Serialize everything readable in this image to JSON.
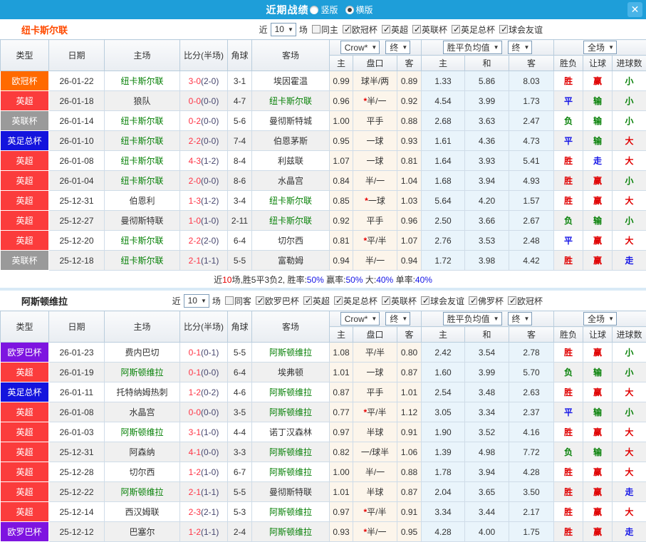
{
  "titlebar": {
    "title": "近期战绩",
    "radios": [
      {
        "label": "竖版",
        "selected": false
      },
      {
        "label": "横版",
        "selected": true
      }
    ]
  },
  "icons": {
    "close": "✕",
    "dropdown_arrow": "▼",
    "checkmark": "✓"
  },
  "colors": {
    "titlebar_bg": "#1e9ed9",
    "tracked_team_green": "#068006",
    "score_ft_red": "#ff3344",
    "win_red": "#e00000",
    "draw_blue": "#1414e6",
    "lose_green": "#068006",
    "leagues": {
      "欧冠杯": "#ff6a00",
      "英超": "#fb3c3c",
      "英联杯": "#9a9a9a",
      "英足总杯": "#1414dd",
      "欧罗巴杯": "#7e14e0"
    }
  },
  "sections": [
    {
      "team": "纽卡斯尔联",
      "team_color": "#ff4a00",
      "filters": {
        "near": "近",
        "count": "10",
        "games": "场",
        "same": "同主",
        "same_checked": false,
        "leagues": [
          "欧冠杯",
          "英超",
          "英联杯",
          "英足总杯",
          "球会友谊"
        ]
      },
      "selects": {
        "source": "Crow*",
        "final_a": "终",
        "mean": "胜平负均值",
        "final_b": "终",
        "scope": "全场"
      },
      "headers": {
        "type": "类型",
        "date": "日期",
        "home": "主场",
        "score": "比分(半场)",
        "corner": "角球",
        "away": "客场",
        "h": "主",
        "handicap": "盘口",
        "a": "客",
        "mh": "主",
        "md": "和",
        "ma": "客",
        "result": "胜负",
        "let": "让球",
        "goals": "进球数"
      },
      "rows": [
        {
          "league": "欧冠杯",
          "date": "26-01-22",
          "home": "纽卡斯尔联",
          "home_team": true,
          "ft": "3-0",
          "ht": "(2-0)",
          "corner": "3-1",
          "away": "埃因霍温",
          "away_team": false,
          "oh": "0.99",
          "hc": "球半/两",
          "star": false,
          "oa": "0.89",
          "mh": "1.33",
          "md": "5.86",
          "ma": "8.03",
          "res": "胜",
          "let": "赢",
          "goal": "小"
        },
        {
          "league": "英超",
          "date": "26-01-18",
          "home": "狼队",
          "home_team": false,
          "ft": "0-0",
          "ht": "(0-0)",
          "corner": "4-7",
          "away": "纽卡斯尔联",
          "away_team": true,
          "oh": "0.96",
          "hc": "半/一",
          "star": true,
          "oa": "0.92",
          "mh": "4.54",
          "md": "3.99",
          "ma": "1.73",
          "res": "平",
          "let": "输",
          "goal": "小"
        },
        {
          "league": "英联杯",
          "date": "26-01-14",
          "home": "纽卡斯尔联",
          "home_team": true,
          "ft": "0-2",
          "ht": "(0-0)",
          "corner": "5-6",
          "away": "曼彻斯特城",
          "away_team": false,
          "oh": "1.00",
          "hc": "平手",
          "star": false,
          "oa": "0.88",
          "mh": "2.68",
          "md": "3.63",
          "ma": "2.47",
          "res": "负",
          "let": "输",
          "goal": "小"
        },
        {
          "league": "英足总杯",
          "date": "26-01-10",
          "home": "纽卡斯尔联",
          "home_team": true,
          "ft": "2-2",
          "ht": "(0-0)",
          "corner": "7-4",
          "away": "伯恩茅斯",
          "away_team": false,
          "oh": "0.95",
          "hc": "一球",
          "star": false,
          "oa": "0.93",
          "mh": "1.61",
          "md": "4.36",
          "ma": "4.73",
          "res": "平",
          "let": "输",
          "goal": "大"
        },
        {
          "league": "英超",
          "date": "26-01-08",
          "home": "纽卡斯尔联",
          "home_team": true,
          "ft": "4-3",
          "ht": "(1-2)",
          "corner": "8-4",
          "away": "利兹联",
          "away_team": false,
          "oh": "1.07",
          "hc": "一球",
          "star": false,
          "oa": "0.81",
          "mh": "1.64",
          "md": "3.93",
          "ma": "5.41",
          "res": "胜",
          "let": "走",
          "goal": "大"
        },
        {
          "league": "英超",
          "date": "26-01-04",
          "home": "纽卡斯尔联",
          "home_team": true,
          "ft": "2-0",
          "ht": "(0-0)",
          "corner": "8-6",
          "away": "水晶宫",
          "away_team": false,
          "oh": "0.84",
          "hc": "半/一",
          "star": false,
          "oa": "1.04",
          "mh": "1.68",
          "md": "3.94",
          "ma": "4.93",
          "res": "胜",
          "let": "赢",
          "goal": "小"
        },
        {
          "league": "英超",
          "date": "25-12-31",
          "home": "伯恩利",
          "home_team": false,
          "ft": "1-3",
          "ht": "(1-2)",
          "corner": "3-4",
          "away": "纽卡斯尔联",
          "away_team": true,
          "oh": "0.85",
          "hc": "一球",
          "star": true,
          "oa": "1.03",
          "mh": "5.64",
          "md": "4.20",
          "ma": "1.57",
          "res": "胜",
          "let": "赢",
          "goal": "大"
        },
        {
          "league": "英超",
          "date": "25-12-27",
          "home": "曼彻斯特联",
          "home_team": false,
          "ft": "1-0",
          "ht": "(1-0)",
          "corner": "2-11",
          "away": "纽卡斯尔联",
          "away_team": true,
          "oh": "0.92",
          "hc": "平手",
          "star": false,
          "oa": "0.96",
          "mh": "2.50",
          "md": "3.66",
          "ma": "2.67",
          "res": "负",
          "let": "输",
          "goal": "小"
        },
        {
          "league": "英超",
          "date": "25-12-20",
          "home": "纽卡斯尔联",
          "home_team": true,
          "ft": "2-2",
          "ht": "(2-0)",
          "corner": "6-4",
          "away": "切尔西",
          "away_team": false,
          "oh": "0.81",
          "hc": "平/半",
          "star": true,
          "oa": "1.07",
          "mh": "2.76",
          "md": "3.53",
          "ma": "2.48",
          "res": "平",
          "let": "赢",
          "goal": "大"
        },
        {
          "league": "英联杯",
          "date": "25-12-18",
          "home": "纽卡斯尔联",
          "home_team": true,
          "ft": "2-1",
          "ht": "(1-1)",
          "corner": "5-5",
          "away": "富勒姆",
          "away_team": false,
          "oh": "0.94",
          "hc": "半/一",
          "star": false,
          "oa": "0.94",
          "mh": "1.72",
          "md": "3.98",
          "ma": "4.42",
          "res": "胜",
          "let": "赢",
          "goal": "走"
        }
      ],
      "summary": [
        {
          "t": "近"
        },
        {
          "t": "10",
          "c": "red"
        },
        {
          "t": "场,胜5平3负2, 胜率:"
        },
        {
          "t": "50%",
          "c": "blue"
        },
        {
          "t": " 赢率:"
        },
        {
          "t": "50%",
          "c": "blue"
        },
        {
          "t": " 大:"
        },
        {
          "t": "40%",
          "c": "blue"
        },
        {
          "t": " 单率:"
        },
        {
          "t": "40%",
          "c": "blue"
        }
      ]
    },
    {
      "team": "阿斯顿维拉",
      "team_color": "#222222",
      "filters": {
        "near": "近",
        "count": "10",
        "games": "场",
        "same": "同客",
        "same_checked": false,
        "leagues": [
          "欧罗巴杯",
          "英超",
          "英足总杯",
          "英联杯",
          "球会友谊",
          "佛罗杯",
          "欧冠杯"
        ]
      },
      "selects": {
        "source": "Crow*",
        "final_a": "终",
        "mean": "胜平负均值",
        "final_b": "终",
        "scope": "全场"
      },
      "headers": {
        "type": "类型",
        "date": "日期",
        "home": "主场",
        "score": "比分(半场)",
        "corner": "角球",
        "away": "客场",
        "h": "主",
        "handicap": "盘口",
        "a": "客",
        "mh": "主",
        "md": "和",
        "ma": "客",
        "result": "胜负",
        "let": "让球",
        "goals": "进球数"
      },
      "rows": [
        {
          "league": "欧罗巴杯",
          "date": "26-01-23",
          "home": "费内巴切",
          "home_team": false,
          "ft": "0-1",
          "ht": "(0-1)",
          "corner": "5-5",
          "away": "阿斯顿维拉",
          "away_team": true,
          "oh": "1.08",
          "hc": "平/半",
          "star": false,
          "oa": "0.80",
          "mh": "2.42",
          "md": "3.54",
          "ma": "2.78",
          "res": "胜",
          "let": "赢",
          "goal": "小"
        },
        {
          "league": "英超",
          "date": "26-01-19",
          "home": "阿斯顿维拉",
          "home_team": true,
          "ft": "0-1",
          "ht": "(0-0)",
          "corner": "6-4",
          "away": "埃弗顿",
          "away_team": false,
          "oh": "1.01",
          "hc": "一球",
          "star": false,
          "oa": "0.87",
          "mh": "1.60",
          "md": "3.99",
          "ma": "5.70",
          "res": "负",
          "let": "输",
          "goal": "小"
        },
        {
          "league": "英足总杯",
          "date": "26-01-11",
          "home": "托特纳姆热刺",
          "home_team": false,
          "ft": "1-2",
          "ht": "(0-2)",
          "corner": "4-6",
          "away": "阿斯顿维拉",
          "away_team": true,
          "oh": "0.87",
          "hc": "平手",
          "star": false,
          "oa": "1.01",
          "mh": "2.54",
          "md": "3.48",
          "ma": "2.63",
          "res": "胜",
          "let": "赢",
          "goal": "大"
        },
        {
          "league": "英超",
          "date": "26-01-08",
          "home": "水晶宫",
          "home_team": false,
          "ft": "0-0",
          "ht": "(0-0)",
          "corner": "3-5",
          "away": "阿斯顿维拉",
          "away_team": true,
          "oh": "0.77",
          "hc": "平/半",
          "star": true,
          "oa": "1.12",
          "mh": "3.05",
          "md": "3.34",
          "ma": "2.37",
          "res": "平",
          "let": "输",
          "goal": "小"
        },
        {
          "league": "英超",
          "date": "26-01-03",
          "home": "阿斯顿维拉",
          "home_team": true,
          "ft": "3-1",
          "ht": "(1-0)",
          "corner": "4-4",
          "away": "诺丁汉森林",
          "away_team": false,
          "oh": "0.97",
          "hc": "半球",
          "star": false,
          "oa": "0.91",
          "mh": "1.90",
          "md": "3.52",
          "ma": "4.16",
          "res": "胜",
          "let": "赢",
          "goal": "大"
        },
        {
          "league": "英超",
          "date": "25-12-31",
          "home": "阿森纳",
          "home_team": false,
          "ft": "4-1",
          "ht": "(0-0)",
          "corner": "3-3",
          "away": "阿斯顿维拉",
          "away_team": true,
          "oh": "0.82",
          "hc": "一/球半",
          "star": false,
          "oa": "1.06",
          "mh": "1.39",
          "md": "4.98",
          "ma": "7.72",
          "res": "负",
          "let": "输",
          "goal": "大"
        },
        {
          "league": "英超",
          "date": "25-12-28",
          "home": "切尔西",
          "home_team": false,
          "ft": "1-2",
          "ht": "(1-0)",
          "corner": "6-7",
          "away": "阿斯顿维拉",
          "away_team": true,
          "oh": "1.00",
          "hc": "半/一",
          "star": false,
          "oa": "0.88",
          "mh": "1.78",
          "md": "3.94",
          "ma": "4.28",
          "res": "胜",
          "let": "赢",
          "goal": "大"
        },
        {
          "league": "英超",
          "date": "25-12-22",
          "home": "阿斯顿维拉",
          "home_team": true,
          "ft": "2-1",
          "ht": "(1-1)",
          "corner": "5-5",
          "away": "曼彻斯特联",
          "away_team": false,
          "oh": "1.01",
          "hc": "半球",
          "star": false,
          "oa": "0.87",
          "mh": "2.04",
          "md": "3.65",
          "ma": "3.50",
          "res": "胜",
          "let": "赢",
          "goal": "走"
        },
        {
          "league": "英超",
          "date": "25-12-14",
          "home": "西汉姆联",
          "home_team": false,
          "ft": "2-3",
          "ht": "(2-1)",
          "corner": "5-3",
          "away": "阿斯顿维拉",
          "away_team": true,
          "oh": "0.97",
          "hc": "平/半",
          "star": true,
          "oa": "0.91",
          "mh": "3.34",
          "md": "3.44",
          "ma": "2.17",
          "res": "胜",
          "let": "赢",
          "goal": "大"
        },
        {
          "league": "欧罗巴杯",
          "date": "25-12-12",
          "home": "巴塞尔",
          "home_team": false,
          "ft": "1-2",
          "ht": "(1-1)",
          "corner": "2-4",
          "away": "阿斯顿维拉",
          "away_team": true,
          "oh": "0.93",
          "hc": "半/一",
          "star": true,
          "oa": "0.95",
          "mh": "4.28",
          "md": "4.00",
          "ma": "1.75",
          "res": "胜",
          "let": "赢",
          "goal": "走"
        }
      ],
      "summary": null
    }
  ]
}
